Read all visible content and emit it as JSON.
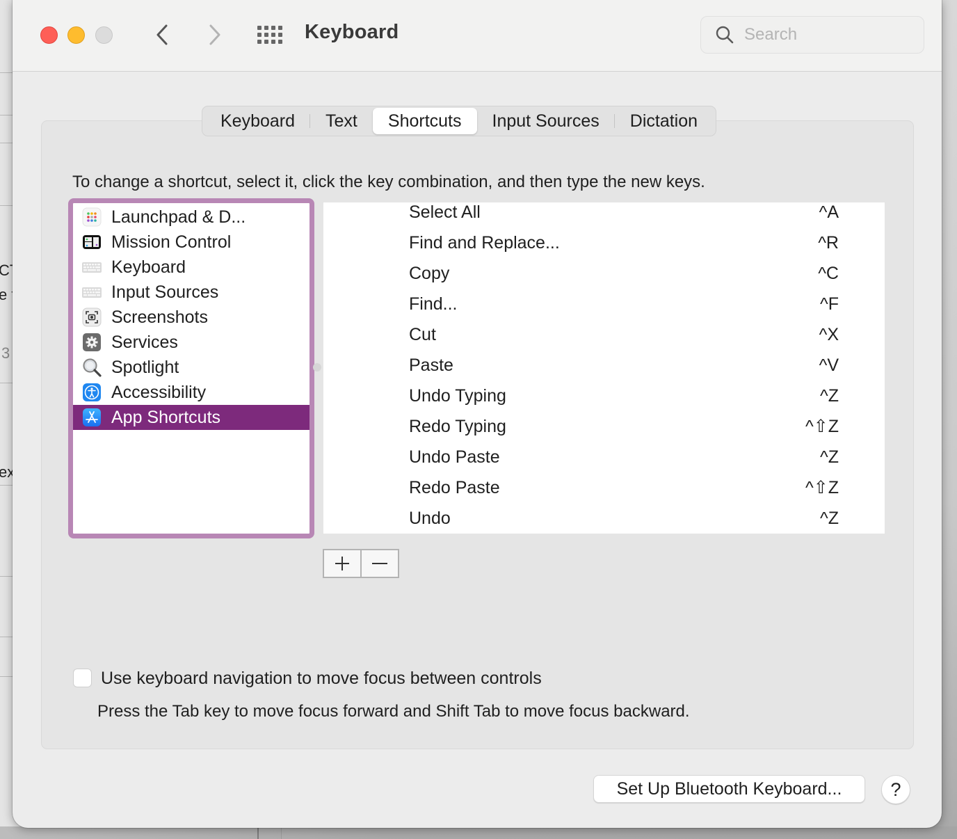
{
  "window": {
    "title": "Keyboard",
    "search": {
      "placeholder": "Search",
      "value": ""
    }
  },
  "tabs": [
    {
      "label": "Keyboard",
      "active": false
    },
    {
      "label": "Text",
      "active": false
    },
    {
      "label": "Shortcuts",
      "active": true
    },
    {
      "label": "Input Sources",
      "active": false
    },
    {
      "label": "Dictation",
      "active": false
    }
  ],
  "instructions": "To change a shortcut, select it, click the key combination, and then type the new keys.",
  "categories": [
    {
      "label": "Launchpad & D...",
      "icon": "launchpad-icon"
    },
    {
      "label": "Mission Control",
      "icon": "mission-control-icon"
    },
    {
      "label": "Keyboard",
      "icon": "keyboard-icon"
    },
    {
      "label": "Input Sources",
      "icon": "input-sources-keyboard-icon"
    },
    {
      "label": "Screenshots",
      "icon": "screenshot-camera-icon"
    },
    {
      "label": "Services",
      "icon": "gear-icon"
    },
    {
      "label": "Spotlight",
      "icon": "magnifier-icon"
    },
    {
      "label": "Accessibility",
      "icon": "accessibility-icon"
    },
    {
      "label": "App Shortcuts",
      "icon": "app-store-icon",
      "selected": true
    }
  ],
  "shortcuts": [
    {
      "name": "Select All",
      "keys": "^A"
    },
    {
      "name": "Find and Replace...",
      "keys": "^R"
    },
    {
      "name": "Copy",
      "keys": "^C"
    },
    {
      "name": "Find...",
      "keys": "^F"
    },
    {
      "name": "Cut",
      "keys": "^X"
    },
    {
      "name": "Paste",
      "keys": "^V"
    },
    {
      "name": "Undo Typing",
      "keys": "^Z"
    },
    {
      "name": "Redo Typing",
      "keys": "^⇧Z"
    },
    {
      "name": "Undo Paste",
      "keys": "^Z"
    },
    {
      "name": "Redo Paste",
      "keys": "^⇧Z"
    },
    {
      "name": "Undo",
      "keys": "^Z"
    }
  ],
  "controls": {
    "add_label": "+",
    "remove_label": "−"
  },
  "keyboard_navigation": {
    "label": "Use keyboard navigation to move focus between controls",
    "checked": false,
    "help": "Press the Tab key to move focus forward and Shift Tab to move focus backward."
  },
  "footer": {
    "bluetooth_button": "Set Up Bluetooth Keyboard...",
    "help_button": "?"
  },
  "background_window": {
    "fragments": [
      "CT",
      "e t",
      "3",
      "ex"
    ]
  },
  "colors": {
    "selection": "#7d2a7c",
    "focus_ring": "#b887b5",
    "close": "#fe5f57",
    "minimize": "#febc2e",
    "zoom_disabled": "#dcdcdc"
  }
}
